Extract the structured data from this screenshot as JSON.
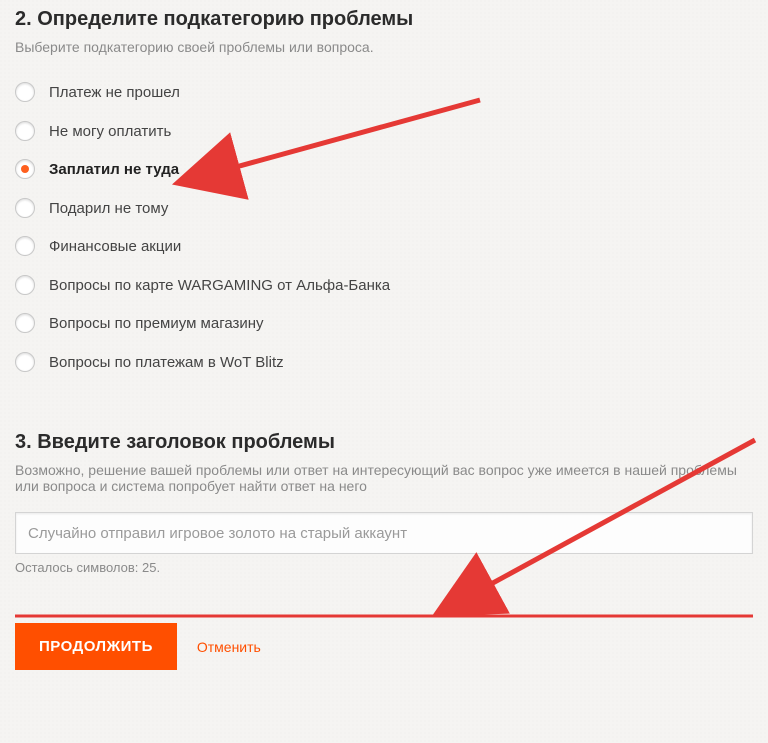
{
  "step2": {
    "heading": "2. Определите подкатегорию проблемы",
    "desc": "Выберите подкатегорию своей проблемы или вопроса.",
    "options": [
      {
        "label": "Платеж не прошел",
        "selected": false
      },
      {
        "label": "Не могу оплатить",
        "selected": false
      },
      {
        "label": "Заплатил не туда",
        "selected": true
      },
      {
        "label": "Подарил не тому",
        "selected": false
      },
      {
        "label": "Финансовые акции",
        "selected": false
      },
      {
        "label": "Вопросы по карте WARGAMING от Альфа-Банка",
        "selected": false
      },
      {
        "label": "Вопросы по премиум магазину",
        "selected": false
      },
      {
        "label": "Вопросы по платежам в WoT Blitz",
        "selected": false
      }
    ]
  },
  "step3": {
    "heading": "3. Введите заголовок проблемы",
    "desc": "Возможно, решение вашей проблемы или ответ на интересующий вас вопрос уже имеется в нашей проблемы или вопроса и система попробует найти ответ на него",
    "input_value": "Случайно отправил игровое золото на старый аккаунт",
    "chars_left": "Осталось символов: 25."
  },
  "actions": {
    "continue": "ПРОДОЛЖИТЬ",
    "cancel": "Отменить"
  },
  "colors": {
    "accent": "#ff4f00"
  }
}
